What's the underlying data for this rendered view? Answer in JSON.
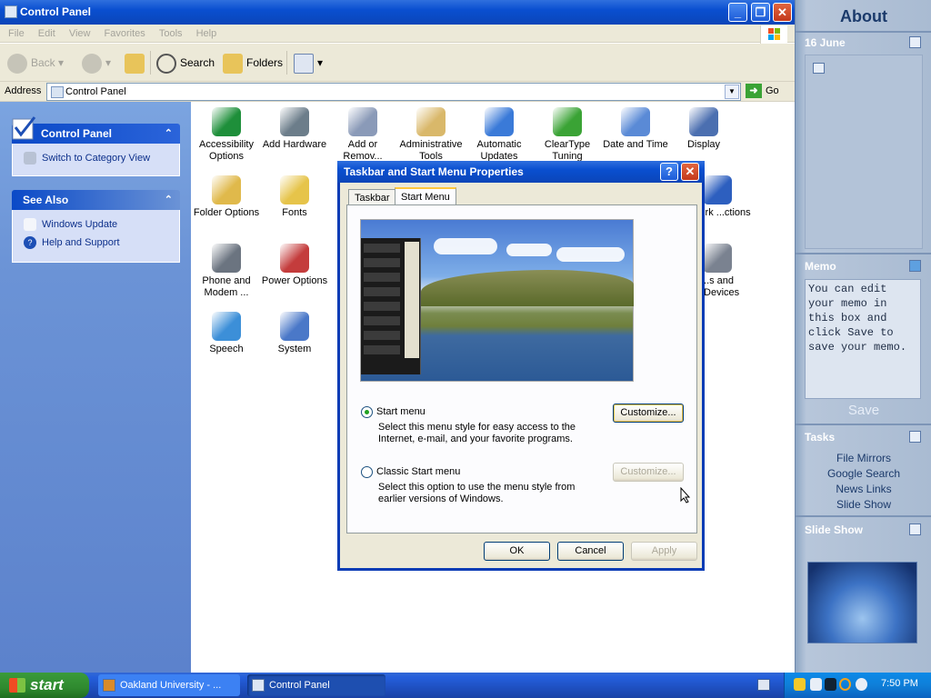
{
  "window": {
    "title": "Control Panel",
    "menu": [
      "File",
      "Edit",
      "View",
      "Favorites",
      "Tools",
      "Help"
    ],
    "toolbar": {
      "back": "Back",
      "search": "Search",
      "folders": "Folders"
    },
    "address": {
      "label": "Address",
      "value": "Control Panel",
      "go": "Go"
    }
  },
  "left_pane": {
    "control_panel_title": "Control Panel",
    "switch_view": "Switch to Category View",
    "see_also_title": "See Also",
    "links": [
      "Windows Update",
      "Help and Support"
    ]
  },
  "icons": [
    {
      "label": "Accessibility Options",
      "color": "#1e8f3a"
    },
    {
      "label": "Add Hardware",
      "color": "#6c7d8a"
    },
    {
      "label": "Add or Remov...",
      "color": "#8a9ab8"
    },
    {
      "label": "Administrative Tools",
      "color": "#d9b86a"
    },
    {
      "label": "Automatic Updates",
      "color": "#3a7ad8"
    },
    {
      "label": "ClearType Tuning",
      "color": "#3aa335"
    },
    {
      "label": "Date and Time",
      "color": "#5a8ad6"
    },
    {
      "label": "Display",
      "color": "#4b6fb0"
    },
    {
      "label": "Folder Options",
      "color": "#e0b94b"
    },
    {
      "label": "Fonts",
      "color": "#e6c44a"
    },
    {
      "label": "...work ...ctions",
      "color": "#2d5fbf"
    },
    {
      "label": "Phone and Modem ...",
      "color": "#6b7480"
    },
    {
      "label": "Power Options",
      "color": "#c43c3c"
    },
    {
      "label": "...s and ...Devices",
      "color": "#7a8290"
    },
    {
      "label": "Speech",
      "color": "#3c8fd8"
    },
    {
      "label": "System",
      "color": "#4a78c8"
    }
  ],
  "dialog": {
    "title": "Taskbar and Start Menu Properties",
    "tabs": [
      "Taskbar",
      "Start Menu"
    ],
    "active_tab": "Start Menu",
    "options": [
      {
        "label": "Start menu",
        "desc1": "Select this menu style for easy access to the",
        "desc2": "Internet, e-mail, and your favorite programs.",
        "selected": true,
        "button": "Customize..."
      },
      {
        "label": "Classic Start menu",
        "desc1": "Select this option to use the menu style from",
        "desc2": "earlier versions of Windows.",
        "selected": false,
        "button": "Customize..."
      }
    ],
    "buttons": {
      "ok": "OK",
      "cancel": "Cancel",
      "apply": "Apply"
    }
  },
  "sidebar": {
    "about": "About",
    "date": "16 June",
    "memo_title": "Memo",
    "memo_text": "You can edit your memo in this box and click Save to save your memo.",
    "save": "Save",
    "tasks_title": "Tasks",
    "tasks": [
      "File Mirrors",
      "Google Search",
      "News Links",
      "Slide Show"
    ],
    "slideshow_title": "Slide Show"
  },
  "taskbar": {
    "start": "start",
    "tasks": [
      "Oakland University - ...",
      "Control Panel"
    ],
    "clock": "7:50 PM"
  }
}
